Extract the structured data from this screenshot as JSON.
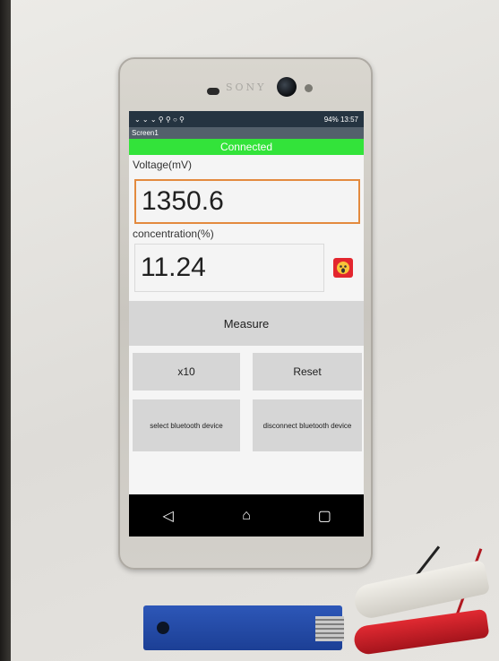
{
  "phone": {
    "brand": "SONY"
  },
  "statusbar": {
    "left_icons": "⌄ ⌄ ⌄ ⚲ ⚲ ○ ⚲",
    "right": "94%  13:57"
  },
  "app": {
    "title": "Screen1",
    "connection_status": "Connected",
    "voltage_label": "Voltage(mV)",
    "voltage_value": "1350.6",
    "concentration_label": "concentration(%)",
    "concentration_value": "11.24",
    "emoji_icon": "face-screaming-icon",
    "measure_button": "Measure",
    "x10_button": "x10",
    "reset_button": "Reset",
    "select_bt_button": "select bluetooth device",
    "disconnect_bt_button": "disconnect bluetooth device"
  },
  "colors": {
    "connected_bar": "#33e33a",
    "voltage_border": "#e38a3e",
    "emoji_bg": "#e3262e"
  },
  "navbar": {
    "back_icon": "back-icon",
    "home_icon": "home-icon",
    "recents_icon": "recents-icon"
  }
}
